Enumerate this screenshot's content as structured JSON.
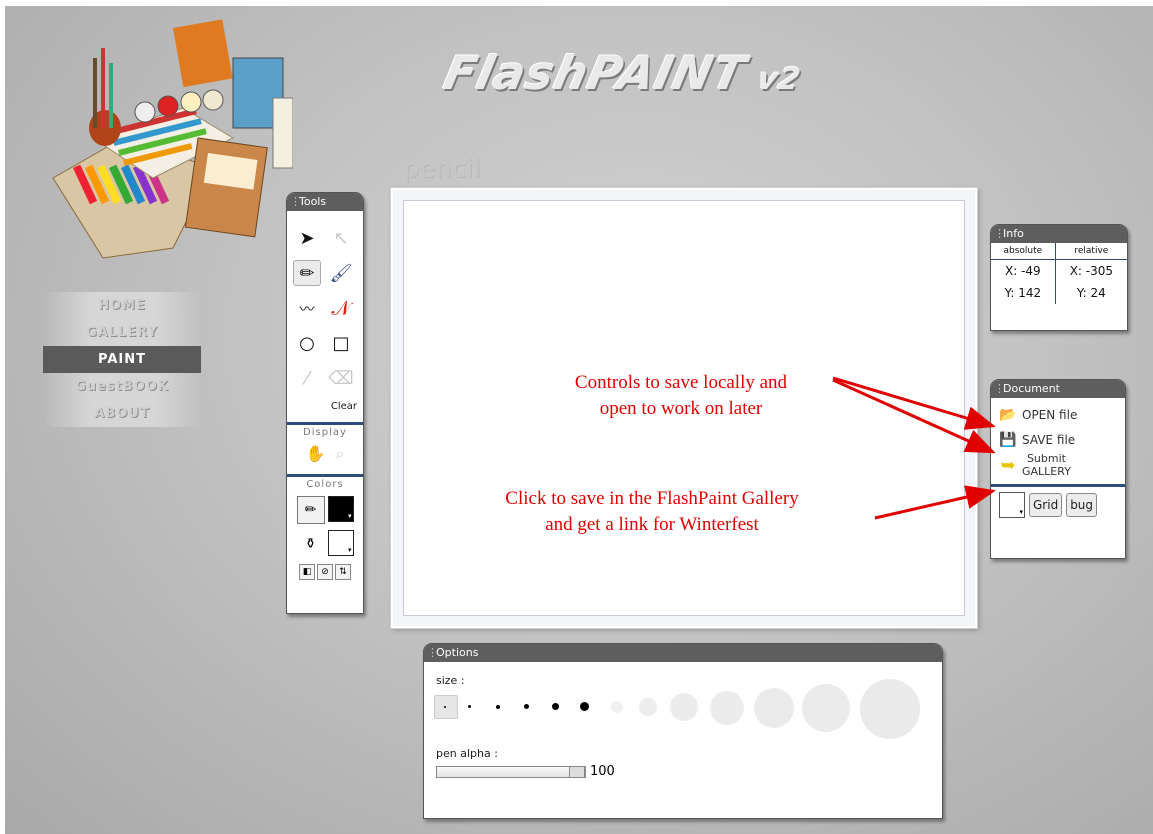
{
  "app": {
    "title": "FlashPAINT",
    "version": "v2",
    "current_tool_label": "pencil"
  },
  "nav": {
    "items": [
      "HOME",
      "GALLERY",
      "PAINT",
      "GuestBOOK",
      "ABOUT"
    ],
    "active": "PAINT"
  },
  "tools_panel": {
    "title": "Tools",
    "tools": [
      "arrow-select",
      "subselect",
      "pencil",
      "brush",
      "curve",
      "polyline",
      "ellipse",
      "rectangle",
      "eyedropper",
      "eraser"
    ],
    "clear_label": "Clear",
    "display_label": "Display",
    "colors_label": "Colors",
    "stroke_color": "#000000",
    "fill_color": "#ffffff"
  },
  "info_panel": {
    "title": "Info",
    "absolute_label": "absolute",
    "relative_label": "relative",
    "abs_x": "X: -49",
    "abs_y": "Y: 142",
    "rel_x": "X: -305",
    "rel_y": "Y: 24"
  },
  "document_panel": {
    "title": "Document",
    "open_label": "OPEN file",
    "save_label": "SAVE file",
    "submit_line1": "Submit",
    "submit_line2": "GALLERY",
    "grid_label": "Grid",
    "bug_label": "bug"
  },
  "options_panel": {
    "title": "Options",
    "size_label": "size :",
    "pen_alpha_label": "pen alpha :",
    "pen_alpha_value": "100"
  },
  "annotations": {
    "save_locally_line1": "Controls to save locally and",
    "save_locally_line2": "open to work on later",
    "gallery_line1": "Click to save in the FlashPaint Gallery",
    "gallery_line2": "and get a link for Winterfest"
  },
  "colors": {
    "accent_blue": "#2d4e7a",
    "panel_header": "#5e5e5e",
    "annotation_red": "#e00000"
  }
}
